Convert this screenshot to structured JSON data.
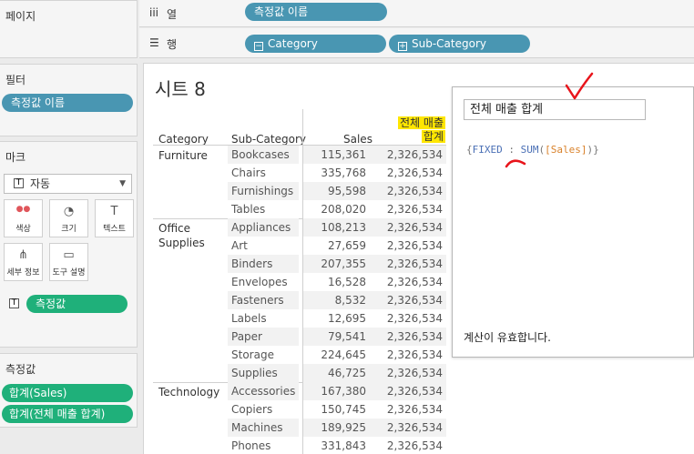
{
  "left_panel": {
    "pages_title": "페이지",
    "filters_title": "필터",
    "filter_pill": "측정값 이름",
    "marks_title": "마크",
    "mark_type": "자동",
    "mark_buttons": [
      {
        "label": "색상",
        "icon": "color-icon"
      },
      {
        "label": "크기",
        "icon": "size-icon"
      },
      {
        "label": "텍스트",
        "icon": "text-icon"
      },
      {
        "label": "세부 정보",
        "icon": "detail-icon"
      },
      {
        "label": "도구 설명",
        "icon": "tooltip-icon"
      }
    ],
    "marks_pill": "측정값",
    "measure_values_title": "측정값",
    "measure_pills": [
      "합계(Sales)",
      "합계(전체 매출 합계)"
    ]
  },
  "shelves": {
    "columns_label": "열",
    "columns_pill": "측정값 이름",
    "rows_label": "행",
    "rows_pills": [
      "Category",
      "Sub-Category"
    ]
  },
  "view": {
    "sheet_title": "시트 8",
    "headers": {
      "category": "Category",
      "subcategory": "Sub-Category",
      "sales": "Sales",
      "total_line1": "전체 매출",
      "total_line2": "합계"
    },
    "categories": [
      {
        "name_lines": [
          "Furniture"
        ],
        "rows": [
          {
            "sub": "Bookcases",
            "sales": "115,361",
            "total": "2,326,534"
          },
          {
            "sub": "Chairs",
            "sales": "335,768",
            "total": "2,326,534"
          },
          {
            "sub": "Furnishings",
            "sales": "95,598",
            "total": "2,326,534"
          },
          {
            "sub": "Tables",
            "sales": "208,020",
            "total": "2,326,534"
          }
        ]
      },
      {
        "name_lines": [
          "Office",
          "Supplies"
        ],
        "rows": [
          {
            "sub": "Appliances",
            "sales": "108,213",
            "total": "2,326,534"
          },
          {
            "sub": "Art",
            "sales": "27,659",
            "total": "2,326,534"
          },
          {
            "sub": "Binders",
            "sales": "207,355",
            "total": "2,326,534"
          },
          {
            "sub": "Envelopes",
            "sales": "16,528",
            "total": "2,326,534"
          },
          {
            "sub": "Fasteners",
            "sales": "8,532",
            "total": "2,326,534"
          },
          {
            "sub": "Labels",
            "sales": "12,695",
            "total": "2,326,534"
          },
          {
            "sub": "Paper",
            "sales": "79,541",
            "total": "2,326,534"
          },
          {
            "sub": "Storage",
            "sales": "224,645",
            "total": "2,326,534"
          },
          {
            "sub": "Supplies",
            "sales": "46,725",
            "total": "2,326,534"
          }
        ]
      },
      {
        "name_lines": [
          "Technology"
        ],
        "rows": [
          {
            "sub": "Accessories",
            "sales": "167,380",
            "total": "2,326,534"
          },
          {
            "sub": "Copiers",
            "sales": "150,745",
            "total": "2,326,534"
          },
          {
            "sub": "Machines",
            "sales": "189,925",
            "total": "2,326,534"
          },
          {
            "sub": "Phones",
            "sales": "331,843",
            "total": "2,326,534"
          }
        ]
      }
    ]
  },
  "calc_dialog": {
    "name": "전체 매출 합계",
    "formula": {
      "open": "{",
      "keyword": "FIXED",
      "colon": " : ",
      "func": "SUM",
      "field": "[Sales]",
      "close": ")}"
    },
    "status": "계산이 유효합니다."
  },
  "colors": {
    "pill_blue": "#4996b2",
    "pill_green": "#1fb07a",
    "highlight": "#ffe600",
    "annotation_red": "#e8141b"
  }
}
